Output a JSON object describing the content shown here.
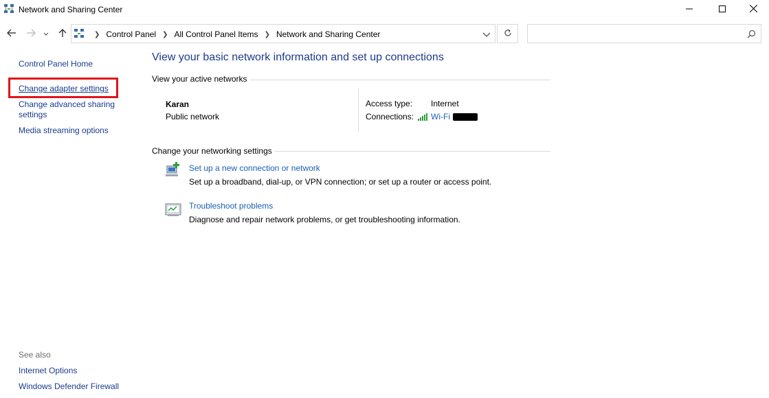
{
  "window": {
    "title": "Network and Sharing Center",
    "icon": "network-center-icon",
    "controls": {
      "minimize": "minimize-icon",
      "maximize": "maximize-icon",
      "close": "close-icon"
    }
  },
  "nav": {
    "breadcrumbs": [
      "Control Panel",
      "All Control Panel Items",
      "Network and Sharing Center"
    ],
    "search_placeholder": ""
  },
  "left_pane": {
    "home": "Control Panel Home",
    "links": [
      "Change adapter settings",
      "Change advanced sharing settings",
      "Media streaming options"
    ],
    "see_also_label": "See also",
    "see_also": [
      "Internet Options",
      "Windows Defender Firewall"
    ]
  },
  "main": {
    "title": "View your basic network information and set up connections",
    "active_networks_heading": "View your active networks",
    "network": {
      "name": "Karan",
      "category": "Public network",
      "access_type_label": "Access type:",
      "access_type_value": "Internet",
      "connections_label": "Connections:",
      "connection_name": "Wi-Fi"
    },
    "change_settings_heading": "Change your networking settings",
    "tasks": [
      {
        "title": "Set up a new connection or network",
        "description": "Set up a broadband, dial-up, or VPN connection; or set up a router or access point.",
        "icon": "new-connection-icon"
      },
      {
        "title": "Troubleshoot problems",
        "description": "Diagnose and repair network problems, or get troubleshooting information.",
        "icon": "troubleshoot-icon"
      }
    ]
  },
  "colors": {
    "link": "#1a5fb4",
    "left_link": "#1a3b8c",
    "title": "#1e3a8a",
    "highlight": "#e2131a"
  }
}
